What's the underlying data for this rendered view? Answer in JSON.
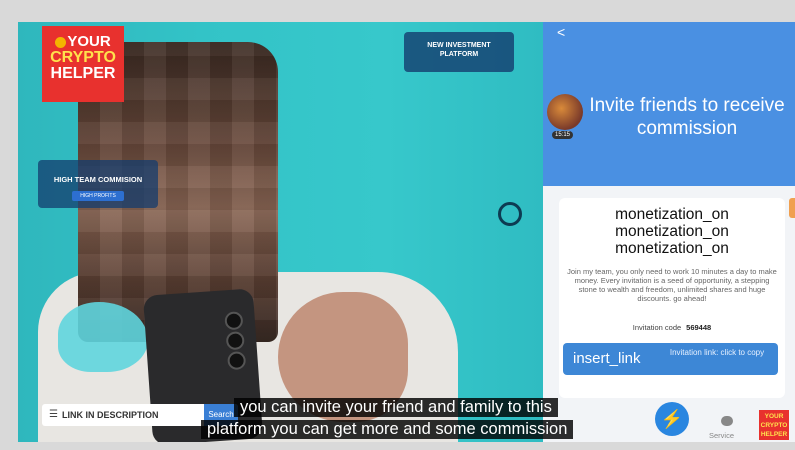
{
  "video": {
    "logo": {
      "line1": "YOUR",
      "line2": "CRYPTO",
      "line3": "HELPER"
    },
    "left_card": {
      "title": "HIGH TEAM COMMISION",
      "button": "HIGH PROFITS"
    },
    "right_card": {
      "title_line1": "NEW INVESTMENT",
      "title_line2": "PLATFORM"
    },
    "search_bar": {
      "label": "LINK IN DESCRIPTION",
      "button": "Search"
    },
    "captions": {
      "line1": "you can invite your friend and family to this",
      "line2": "platform you can get more and some commission"
    }
  },
  "app": {
    "back": "<",
    "title": "Invite friends to receive commission",
    "avatar_time": "15:15",
    "icon_texts": [
      "monetization_on",
      "monetization_on",
      "monetization_on"
    ],
    "description": "Join my team, you only need to work 10 minutes a day to make money. Every invitation is a seed of opportunity, a stepping stone to wealth and freedom, unlimited shares and huge discounts. go ahead!",
    "invitation_code_label": "Invitation code",
    "invitation_code": "569448",
    "link_icon_text": "insert_link",
    "link_label": "Invitation link: click to copy",
    "nav": {
      "service": "Service",
      "mini_logo": "YOUR CRYPTO HELPER"
    }
  }
}
